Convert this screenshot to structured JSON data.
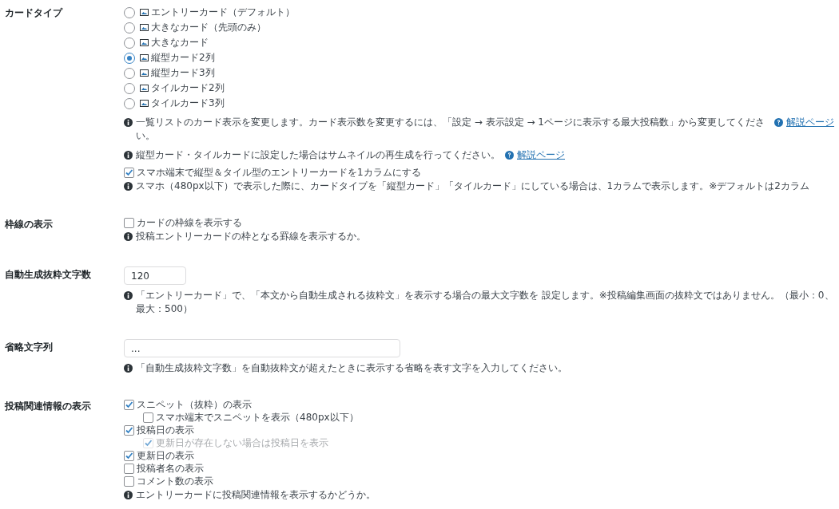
{
  "sections": [
    {
      "label": "カードタイプ",
      "items": [
        {
          "kind": "radio",
          "label": "エントリーカード（デフォルト）",
          "selected": false
        },
        {
          "kind": "radio",
          "label": "大きなカード（先頭のみ）",
          "selected": false
        },
        {
          "kind": "radio",
          "label": "大きなカード",
          "selected": false
        },
        {
          "kind": "radio",
          "label": "縦型カード2列",
          "selected": true
        },
        {
          "kind": "radio",
          "label": "縦型カード3列",
          "selected": false
        },
        {
          "kind": "radio",
          "label": "タイルカード2列",
          "selected": false
        },
        {
          "kind": "radio",
          "label": "タイルカード3列",
          "selected": false
        },
        {
          "kind": "note",
          "text": "一覧リストのカード表示を変更します。カード表示数を変更するには、「設定 → 表示設定 → 1ページに表示する最大投稿数」から変更してください。",
          "link": "解説ページ"
        },
        {
          "kind": "note",
          "text": "縦型カード・タイルカードに設定した場合はサムネイルの再生成を行ってください。",
          "link": "解説ページ"
        },
        {
          "kind": "checkbox",
          "label": "スマホ端末で縦型＆タイル型のエントリーカードを1カラムにする",
          "checked": true,
          "disabled": false
        },
        {
          "kind": "note",
          "text": "スマホ（480px以下）で表示した際に、カードタイプを「縦型カード」「タイルカード」にしている場合は、1カラムで表示します。※デフォルトは2カラム"
        }
      ]
    },
    {
      "label": "枠線の表示",
      "items": [
        {
          "kind": "checkbox",
          "label": "カードの枠線を表示する",
          "checked": false,
          "disabled": false
        },
        {
          "kind": "note",
          "text": "投稿エントリーカードの枠となる罫線を表示するか。"
        }
      ]
    },
    {
      "label": "自動生成抜粋文字数",
      "items": [
        {
          "kind": "number_input",
          "value": "120"
        },
        {
          "kind": "note",
          "text": "「エントリーカード」で、「本文から自動生成される抜粋文」を表示する場合の最大文字数を 設定します。※投稿編集画面の抜粋文ではありません。（最小：0、最大：500）"
        }
      ]
    },
    {
      "label": "省略文字列",
      "items": [
        {
          "kind": "text_input",
          "value": "..."
        },
        {
          "kind": "note",
          "text": "「自動生成抜粋文字数」を自動抜粋文が超えたときに表示する省略を表す文字を入力してください。"
        }
      ]
    },
    {
      "label": "投稿関連情報の表示",
      "items": [
        {
          "kind": "checkbox",
          "label": "スニペット（抜粋）の表示",
          "checked": true,
          "disabled": false,
          "children": [
            {
              "label": "スマホ端末でスニペットを表示（480px以下）",
              "checked": false,
              "disabled": false
            }
          ]
        },
        {
          "kind": "checkbox",
          "label": "投稿日の表示",
          "checked": true,
          "disabled": false,
          "children": [
            {
              "label": "更新日が存在しない場合は投稿日を表示",
              "checked": true,
              "disabled": true
            }
          ]
        },
        {
          "kind": "checkbox",
          "label": "更新日の表示",
          "checked": true,
          "disabled": false
        },
        {
          "kind": "checkbox",
          "label": "投稿者名の表示",
          "checked": false,
          "disabled": false
        },
        {
          "kind": "checkbox",
          "label": "コメント数の表示",
          "checked": false,
          "disabled": false
        },
        {
          "kind": "note",
          "text": "エントリーカードに投稿関連情報を表示するかどうか。"
        }
      ]
    }
  ]
}
